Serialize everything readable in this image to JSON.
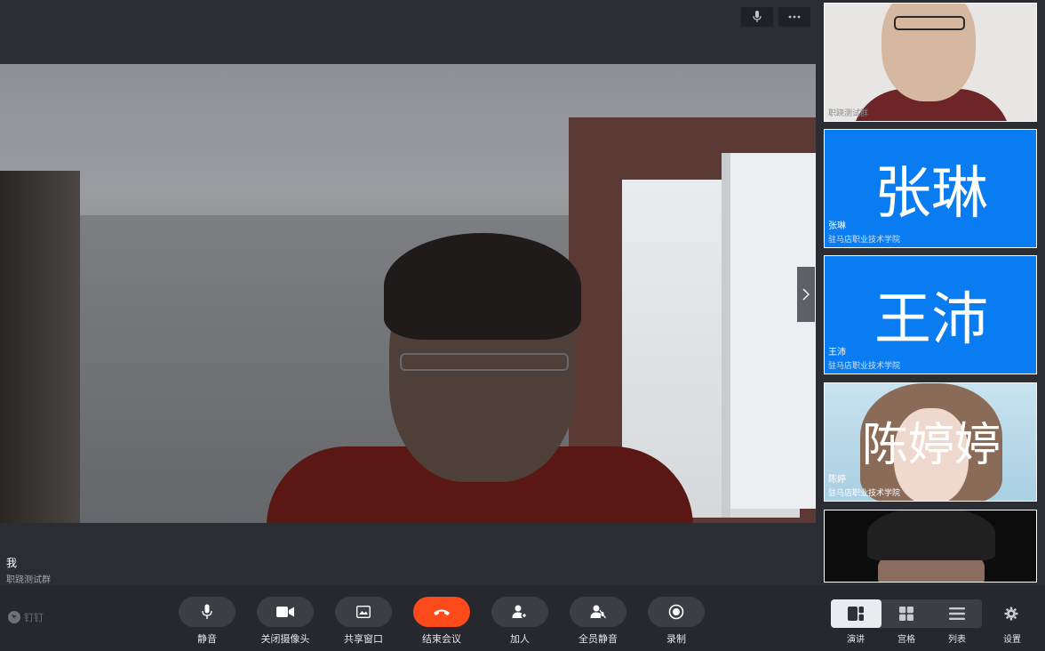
{
  "main": {
    "self_name": "我",
    "self_group": "职跷测试群"
  },
  "participants": [
    {
      "name": "",
      "org": "职跷测试群"
    },
    {
      "avatar_text": "张琳",
      "name": "张琳",
      "org": "驻马店职业技术学院"
    },
    {
      "avatar_text": "王沛",
      "name": "王沛",
      "org": "驻马店职业技术学院"
    },
    {
      "avatar_text": "陈婷婷",
      "name": "陈婷",
      "org": "驻马店职业技术学院"
    },
    {
      "name": "",
      "org": ""
    }
  ],
  "brand": {
    "label": "钉钉"
  },
  "controls": {
    "mute": "静音",
    "camera_off": "关闭摄像头",
    "share_window": "共享窗口",
    "end_meeting": "结束会议",
    "add_person": "加人",
    "mute_all": "全员静音",
    "record": "录制"
  },
  "views": {
    "speaker": "演讲",
    "grid": "宫格",
    "list": "列表",
    "settings": "设置"
  },
  "colors": {
    "accent_blue": "#0a7cf2",
    "end_red": "#fc4a1a",
    "toolbar_bg": "#26282d"
  }
}
